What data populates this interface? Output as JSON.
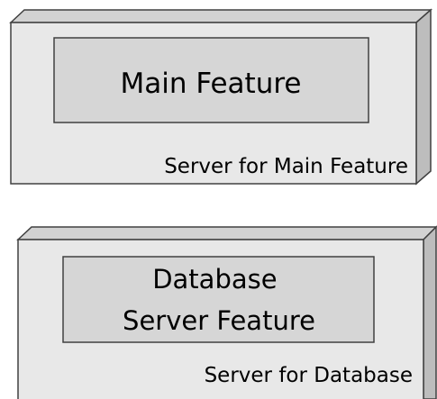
{
  "servers": [
    {
      "feature_lines": [
        "Main Feature"
      ],
      "server_label": "Server for Main Feature"
    },
    {
      "feature_lines": [
        "Database",
        "Server Feature"
      ],
      "server_label": "Server for Database"
    }
  ],
  "colors": {
    "server_front": "#e8e8e8",
    "server_top": "#d2d2d2",
    "server_side": "#bdbdbd",
    "feature_fill": "#d6d6d6",
    "stroke": "#404040",
    "text": "#000000"
  }
}
